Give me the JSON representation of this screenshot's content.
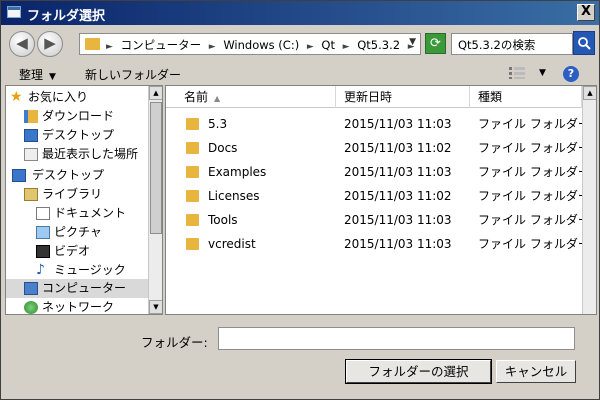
{
  "window": {
    "title": "フォルダ選択",
    "close_label": "X"
  },
  "address": {
    "crumbs": [
      "コンピューター",
      "Windows (C:)",
      "Qt",
      "Qt5.3.2"
    ],
    "separator": "►",
    "dropdown": "▼"
  },
  "nav_buttons": {
    "back": "◀",
    "forward": "▶"
  },
  "refresh_label": "⟳",
  "search": {
    "value": "Qt5.3.2の検索"
  },
  "toolbar": {
    "organize": "整理",
    "organize_arrow": "▼",
    "new_folder": "新しいフォルダー",
    "view_arrow": "▼",
    "help": "?"
  },
  "nav": {
    "items": [
      {
        "label": "お気に入り",
        "icon": "star-icon"
      },
      {
        "label": "ダウンロード",
        "icon": "downloads-folder-icon"
      },
      {
        "label": "デスクトップ",
        "icon": "desktop-icon"
      },
      {
        "label": "最近表示した場所",
        "icon": "recent-places-icon"
      },
      {
        "label": "デスクトップ",
        "icon": "desktop-icon"
      },
      {
        "label": "ライブラリ",
        "icon": "library-icon"
      },
      {
        "label": "ドキュメント",
        "icon": "documents-icon"
      },
      {
        "label": "ピクチャ",
        "icon": "pictures-icon"
      },
      {
        "label": "ビデオ",
        "icon": "videos-icon"
      },
      {
        "label": "ミュージック",
        "icon": "music-icon"
      },
      {
        "label": "コンピューター",
        "icon": "computer-icon"
      },
      {
        "label": "ネットワーク",
        "icon": "network-icon"
      }
    ]
  },
  "files": {
    "columns": {
      "name": "名前",
      "date": "更新日時",
      "type": "種類"
    },
    "sort_indicator": "▲",
    "rows": [
      {
        "name": "5.3",
        "date": "2015/11/03 11:03",
        "type": "ファイル フォルダー"
      },
      {
        "name": "Docs",
        "date": "2015/11/03 11:02",
        "type": "ファイル フォルダー"
      },
      {
        "name": "Examples",
        "date": "2015/11/03 11:03",
        "type": "ファイル フォルダー"
      },
      {
        "name": "Licenses",
        "date": "2015/11/03 11:02",
        "type": "ファイル フォルダー"
      },
      {
        "name": "Tools",
        "date": "2015/11/03 11:03",
        "type": "ファイル フォルダー"
      },
      {
        "name": "vcredist",
        "date": "2015/11/03 11:03",
        "type": "ファイル フォルダー"
      }
    ]
  },
  "footer": {
    "folder_label": "フォルダー:",
    "folder_value": "",
    "select_button": "フォルダーの選択",
    "cancel_button": "キャンセル"
  }
}
